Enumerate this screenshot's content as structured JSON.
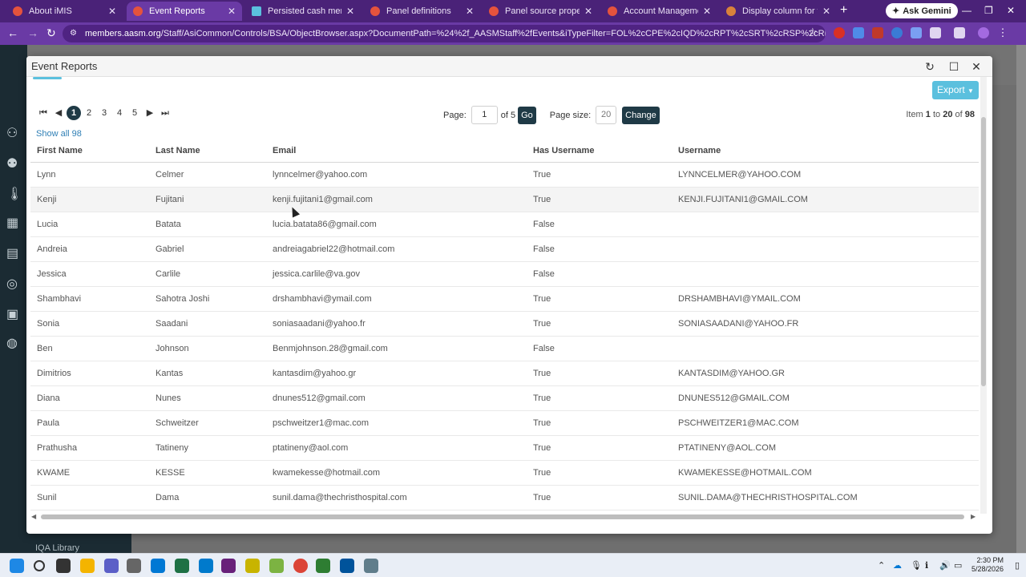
{
  "browser": {
    "tabs": [
      {
        "title": "About iMIS",
        "color": "#e5533d",
        "active": false
      },
      {
        "title": "Event Reports",
        "color": "#e5533d",
        "active": true
      },
      {
        "title": "Persisted cash membership",
        "color": "#5bc0de",
        "active": false
      },
      {
        "title": "Panel definitions",
        "color": "#e5533d",
        "active": false
      },
      {
        "title": "Panel source properties",
        "color": "#e5533d",
        "active": false
      },
      {
        "title": "Account Management Setti",
        "color": "#e5533d",
        "active": false
      },
      {
        "title": "Display column for field valu",
        "color": "#d9823b",
        "active": false
      }
    ],
    "gemini_label": "Ask Gemini",
    "url_host": "members.aasm.org",
    "url_path": "/Staff/AsiCommon/Controls/BSA/ObjectBrowser.aspx?DocumentPath=%24%2f_AASMStaff%2fEvents&iTypeFilter=FOL%2cCPE%2cIQD%2cRPT%2cSRT%2cRSP%2cRDL&ShowHierarchyTree=False&D..."
  },
  "page": {
    "sidebar_bottom_label": "IQA Library"
  },
  "modal": {
    "title": "Event Reports",
    "export_label": "Export",
    "pager": {
      "pages": [
        "1",
        "2",
        "3",
        "4",
        "5"
      ],
      "current": "1",
      "show_all": "Show all 98",
      "page_label": "Page:",
      "page_value": "1",
      "of_label": "of 5",
      "go_label": "Go",
      "size_label": "Page size:",
      "size_value": "20",
      "change_label": "Change",
      "item_prefix": "Item ",
      "item_from": "1",
      "item_to_label": " to ",
      "item_to": "20",
      "item_of_label": " of ",
      "item_total": "98"
    },
    "columns": [
      "First Name",
      "Last Name",
      "Email",
      "Has Username",
      "Username"
    ],
    "rows": [
      [
        "Lynn",
        "Celmer",
        "lynncelmer@yahoo.com",
        "True",
        "LYNNCELMER@YAHOO.COM"
      ],
      [
        "Kenji",
        "Fujitani",
        "kenji.fujitani1@gmail.com",
        "True",
        "KENJI.FUJITANI1@GMAIL.COM"
      ],
      [
        "Lucia",
        "Batata",
        "lucia.batata86@gmail.com",
        "False",
        ""
      ],
      [
        "Andreia",
        "Gabriel",
        "andreiagabriel22@hotmail.com",
        "False",
        ""
      ],
      [
        "Jessica",
        "Carlile",
        "jessica.carlile@va.gov",
        "False",
        ""
      ],
      [
        "Shambhavi",
        "Sahotra Joshi",
        "drshambhavi@ymail.com",
        "True",
        "DRSHAMBHAVI@YMAIL.COM"
      ],
      [
        "Sonia",
        "Saadani",
        "soniasaadani@yahoo.fr",
        "True",
        "SONIASAADANI@YAHOO.FR"
      ],
      [
        "Ben",
        "Johnson",
        "Benmjohnson.28@gmail.com",
        "False",
        ""
      ],
      [
        "Dimitrios",
        "Kantas",
        "kantasdim@yahoo.gr",
        "True",
        "KANTASDIM@YAHOO.GR"
      ],
      [
        "Diana",
        "Nunes",
        "dnunes512@gmail.com",
        "True",
        "DNUNES512@GMAIL.COM"
      ],
      [
        "Paula",
        "Schweitzer",
        "pschweitzer1@mac.com",
        "True",
        "PSCHWEITZER1@MAC.COM"
      ],
      [
        "Prathusha",
        "Tatineny",
        "ptatineny@aol.com",
        "True",
        "PTATINENY@AOL.COM"
      ],
      [
        "KWAME",
        "KESSE",
        "kwamekesse@hotmail.com",
        "True",
        "KWAMEKESSE@HOTMAIL.COM"
      ],
      [
        "Sunil",
        "Dama",
        "sunil.dama@thechristhospital.com",
        "True",
        "SUNIL.DAMA@THECHRISTHOSPITAL.COM"
      ]
    ],
    "highlighted_row": 1
  },
  "taskbar": {
    "time": "2:30 PM",
    "date": "5/28/2026"
  },
  "colors": {
    "accent": "#5bc0de",
    "dark": "#1f3a46",
    "browser": "#6a3aa5"
  }
}
